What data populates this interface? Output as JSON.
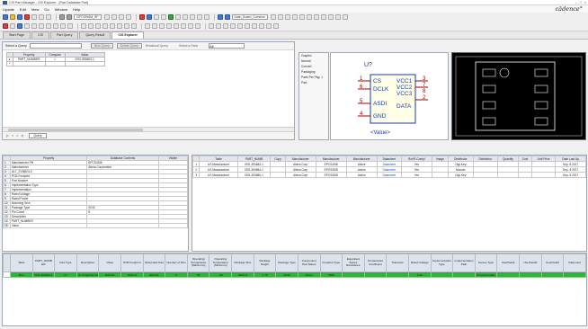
{
  "window": {
    "title": "CIS Part Manager - CIS Explorer - [Part Database Part]",
    "brand": "cādence°",
    "controls": [
      "–",
      "□",
      "×"
    ]
  },
  "menu": [
    "Update",
    "Edit",
    "View",
    "Go",
    "Window",
    "Help"
  ],
  "toolbar": {
    "combo1": "OPTIONSM_RF",
    "combo2": "Dash_Board_Common"
  },
  "tabs": [
    "Start Page",
    "CIS",
    "Part Query",
    "Query Result",
    "CIS Explorer"
  ],
  "query": {
    "select_label": "Select a Query",
    "buttons": [
      "New Query",
      "Delete Query"
    ],
    "relational_label": "Relational Query",
    "select_a_part_label": "Select a Parts",
    "select_a_part_value": "All",
    "headers": [
      "Property",
      "Compare",
      "Value"
    ],
    "rows": [
      [
        "PART_NUMBER",
        "=",
        "ISSI-393683-1"
      ]
    ],
    "nav": [
      "|<",
      "<",
      ">",
      ">|"
    ],
    "query_tab": "Query"
  },
  "symbol_panel": {
    "rows": [
      "Graphic",
      "Normal",
      "Convert",
      "Packaging",
      "Parts Per Pkg: 1",
      "Part:"
    ]
  },
  "symbol": {
    "ref": "U?",
    "value": "<Value>",
    "pins_left": [
      {
        "num": "1",
        "name": "CS"
      },
      {
        "num": "6",
        "name": "DCLK"
      },
      {
        "num": "5",
        "name": "ASDI"
      },
      {
        "num": "4",
        "name": "GND"
      }
    ],
    "pins_right": [
      {
        "num": "3",
        "name": "VCC1"
      },
      {
        "num": "7",
        "name": "VCC2"
      },
      {
        "num": "8",
        "name": "VCC3"
      },
      {
        "num": "2",
        "name": "DATA"
      }
    ]
  },
  "properties": {
    "headers": [
      "",
      "Property",
      "Database Contents",
      "Visible"
    ],
    "rows": [
      [
        "1",
        "Manufacturer PN",
        "EPCS4SI8",
        ""
      ],
      [
        "2",
        "Manufacturer",
        "Altera Corporation",
        ""
      ],
      [
        "3",
        "ALT_SYMBOLS",
        "",
        ""
      ],
      [
        "4",
        "PCB Footprint",
        "",
        ""
      ],
      [
        "5",
        "Part Number",
        "",
        ""
      ],
      [
        "6",
        "Implementation Type",
        "",
        ""
      ],
      [
        "7",
        "Implementation",
        "",
        ""
      ],
      [
        "8",
        "Rated Voltage",
        "",
        ""
      ],
      [
        "9",
        "Rated Power",
        "",
        ""
      ],
      [
        "10",
        "Mounting Tech",
        "",
        ""
      ],
      [
        "11",
        "Package Type",
        "SOIC",
        ""
      ],
      [
        "12",
        "Pin Count",
        "8",
        ""
      ],
      [
        "13",
        "Description",
        "",
        ""
      ],
      [
        "14",
        "PART_NUMBER",
        "",
        ""
      ],
      [
        "15",
        "Value",
        "",
        ""
      ]
    ]
  },
  "parts": {
    "headers": [
      "",
      "Table",
      "PART_NUMB",
      "Copy",
      "Manufacturer",
      "Manufacturer",
      "Manufacturer",
      "Datasheet",
      "RoHS Compl",
      "Image",
      "Distributor",
      "Distributor",
      "Quantity",
      "Cost",
      "Unit Price",
      "Date Last Up"
    ],
    "rows": [
      [
        "1",
        "US Manufacturer",
        "ISSI-393683-1",
        "",
        "Altera Corp",
        "EPCS4SI8",
        "Active",
        "Datasheet",
        "Yes",
        "",
        "Digi-Key",
        "",
        "",
        "",
        "",
        "Sep. 8 2017"
      ],
      [
        "2",
        "US Manufacturer",
        "ISSI-393684-1",
        "",
        "Altera Corp",
        "EPCS4SI8",
        "Active",
        "Datasheet",
        "Yes",
        "",
        "Mouser",
        "",
        "",
        "",
        "",
        "Sep. 8 2017"
      ],
      [
        "3",
        "US Manufacturer",
        "ISSI-393685-1",
        "",
        "Altera Corp",
        "EPCS4SI8",
        "Active",
        "Datasheet",
        "Yes",
        "",
        "Digi-Key",
        "",
        "",
        "",
        "",
        "Sep. 8 2017"
      ]
    ]
  },
  "grid": {
    "headers": [
      "",
      "Table",
      "PART_NUMB ER",
      "Part Type",
      "Description",
      "Value",
      "PCB Footprint",
      "Schematic Part",
      "Number of Pins",
      "Operating Temperature (Maximum)",
      "Operating Temperature (Minimum)",
      "Package Size",
      "Package Height",
      "Package Type",
      "Component Part Status",
      "Footprint Type",
      "Equivalent Series Resistance",
      "Temperature Coefficient",
      "Tolerance",
      "Rated Voltage",
      "Implementation Type",
      "Implementation Path",
      "Device Type",
      "UserField1",
      "UserField2",
      "UserField3",
      "Data Last"
    ],
    "rows": [
      [
        "",
        "Misc",
        "ISSI-393683-1",
        "IC",
        "IC, Programmable",
        "EPCS4",
        "SOIC-8",
        "EPCS4",
        "8",
        "85",
        "-40",
        "SOIC-8",
        "1.75",
        "SOIC",
        "Active",
        "SMD",
        "",
        "",
        "",
        "3.3V",
        "",
        "",
        "Programmable",
        "",
        "",
        "",
        ""
      ]
    ]
  },
  "colors": {
    "accent": "#2a5db0",
    "grid_row": "#2eb33a",
    "footprint_bg": "#000000"
  }
}
